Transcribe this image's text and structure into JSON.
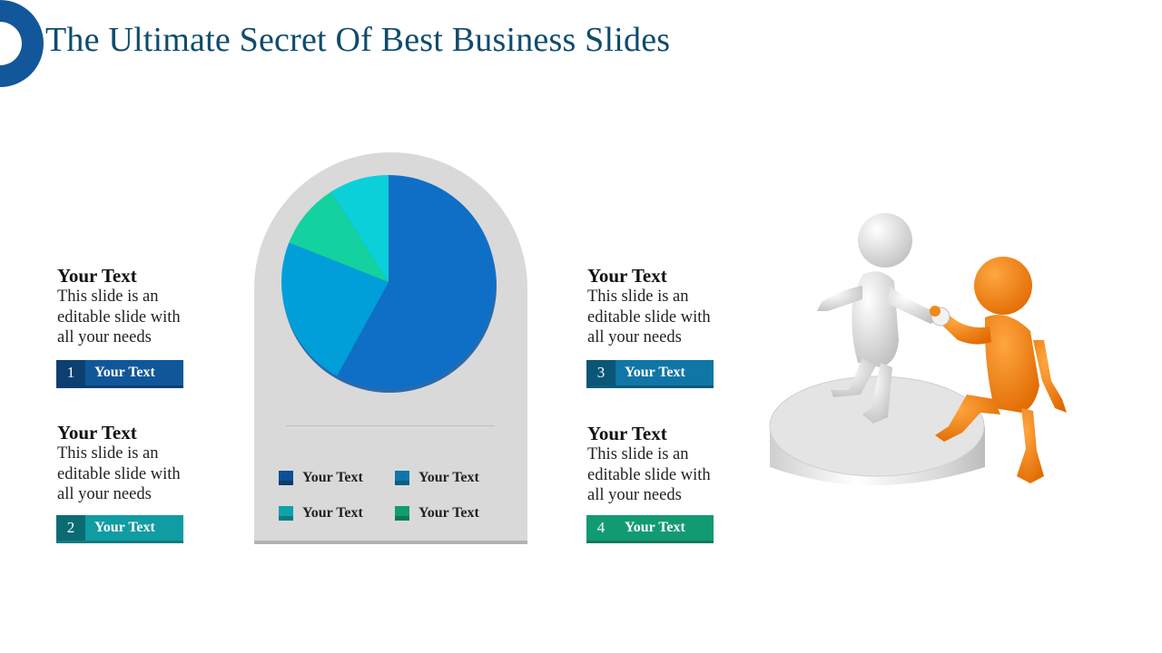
{
  "slide": {
    "title": "The Ultimate Secret Of Best Business Slides",
    "accent_color": "#12579a"
  },
  "info_blocks": [
    {
      "heading": "Your Text",
      "body_lines": [
        "This slide is an",
        "editable slide with",
        "all your needs"
      ]
    },
    {
      "heading": "Your Text",
      "body_lines": [
        "This slide is an",
        "editable slide with",
        "all your needs"
      ]
    },
    {
      "heading": "Your Text",
      "body_lines": [
        "This slide is an",
        "editable slide with",
        "all your needs"
      ]
    },
    {
      "heading": "Your Text",
      "body_lines": [
        "This slide is an",
        "editable slide with",
        "all your needs"
      ]
    }
  ],
  "tags": [
    {
      "number": "1",
      "label": "Your Text",
      "num_color": "#0d3f70",
      "label_color": "#10579a",
      "bottom_color": "#0b3f70"
    },
    {
      "number": "2",
      "label": "Your Text",
      "num_color": "#0b6b73",
      "label_color": "#109ca3",
      "bottom_color": "#0b7c80"
    },
    {
      "number": "3",
      "label": "Your Text",
      "num_color": "#0b5677",
      "label_color": "#0f76a6",
      "bottom_color": "#0b5a7a"
    },
    {
      "number": "4",
      "label": "Your Text",
      "num_color": "#129b73",
      "label_color": "#129b73",
      "bottom_color": "#0e7a5a"
    }
  ],
  "legend": [
    {
      "label": "Your Text",
      "color": "#0d4f94",
      "dark": "#0a3c70"
    },
    {
      "label": "Your Text",
      "color": "#0e76a8",
      "dark": "#0b5d82"
    },
    {
      "label": "Your Text",
      "color": "#10a2a8",
      "dark": "#0c7c80"
    },
    {
      "label": "Your Text",
      "color": "#139b74",
      "dark": "#0e7757"
    }
  ],
  "illustration": {
    "description": "white and orange 3D figures shaking hands on a podium",
    "icon": "teamwork-help-icon"
  },
  "chart_data": {
    "type": "pie",
    "title": "",
    "start_angle": "12 o'clock",
    "direction": "clockwise",
    "categories": [
      "Your Text",
      "Your Text",
      "Your Text",
      "Your Text"
    ],
    "values": [
      58,
      23,
      10,
      9
    ],
    "units": "percent (estimated)",
    "slice_colors": [
      "#0f6fc6",
      "#009fd9",
      "#14d1a0",
      "#0cd0d9"
    ],
    "legend": "below chart, 2x2 grid"
  }
}
